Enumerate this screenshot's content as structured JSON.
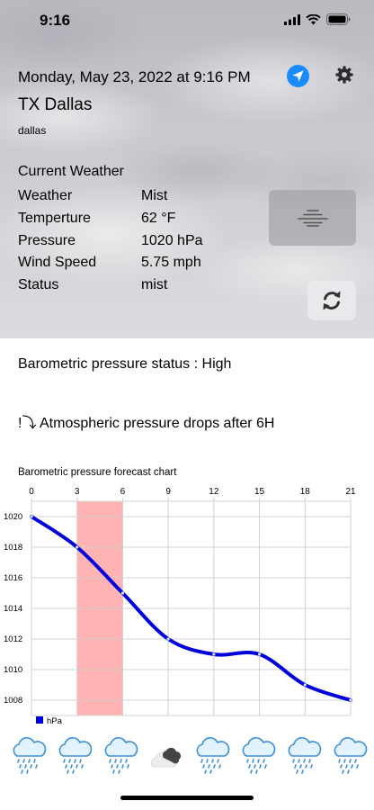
{
  "status_bar": {
    "time": "9:16",
    "icons": [
      "signal-bars-icon",
      "wifi-icon",
      "battery-icon"
    ]
  },
  "header": {
    "date": "Monday, May 23, 2022 at 9:16 PM",
    "city": "TX Dallas",
    "city_sub": "dallas",
    "icons": {
      "location": "navigation-arrow-icon",
      "settings": "gear-icon"
    }
  },
  "current_weather": {
    "title": "Current Weather",
    "rows": [
      {
        "label": "Weather",
        "value": "Mist"
      },
      {
        "label": "Temperture",
        "value": "62 °F"
      },
      {
        "label": "Pressure",
        "value": "1020 hPa"
      },
      {
        "label": "Wind Speed",
        "value": "5.75 mph"
      },
      {
        "label": "Status",
        "value": "mist"
      }
    ],
    "condition_icon": "mist-lines-icon",
    "refresh_icon": "refresh-icon"
  },
  "pressure_status": "Barometric pressure status : High",
  "pressure_trend": "!⤵ Atmospheric pressure drops after 6H",
  "chart_data": {
    "type": "line",
    "title": "Barometric pressure forecast chart",
    "x": [
      0,
      3,
      6,
      9,
      12,
      15,
      18,
      21
    ],
    "x_ticks": [
      "0",
      "3",
      "6",
      "9",
      "12",
      "15",
      "18",
      "21"
    ],
    "y_ticks": [
      "1020",
      "1018",
      "1016",
      "1014",
      "1012",
      "1010",
      "1008"
    ],
    "series": [
      {
        "name": "hPa",
        "color": "#0000dd",
        "values": [
          1020,
          1018,
          1015,
          1012,
          1011,
          1011,
          1009,
          1008
        ]
      }
    ],
    "highlight_range": [
      3,
      6
    ],
    "highlight_color": "#ffb3b3",
    "xlim": [
      0,
      21
    ],
    "ylim": [
      1007,
      1021
    ],
    "grid": true,
    "legend": "bottom-left"
  },
  "forecast_icons": [
    "rain-cloud-icon",
    "rain-cloud-icon",
    "rain-cloud-icon",
    "cloudy-icon",
    "rain-cloud-icon",
    "rain-cloud-icon",
    "rain-cloud-icon",
    "rain-cloud-icon"
  ]
}
